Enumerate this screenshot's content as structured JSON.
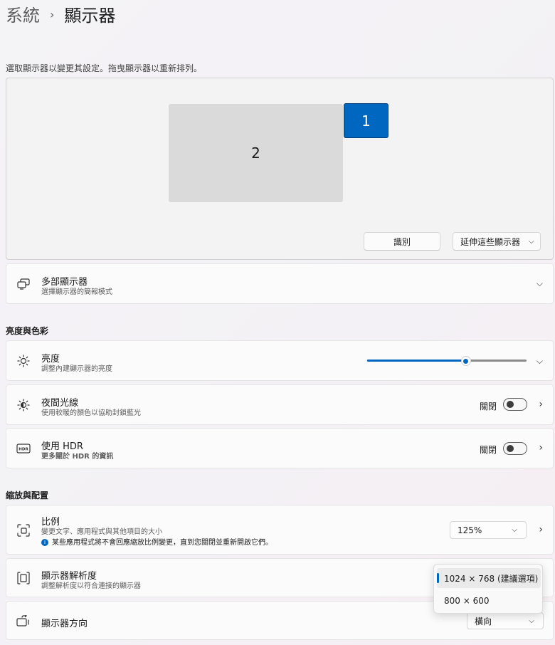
{
  "breadcrumb": {
    "parent": "系統",
    "current": "顯示器"
  },
  "hint": "選取顯示器以變更其設定。拖曳顯示器以重新排列。",
  "displays": {
    "monitor1_label": "1",
    "monitor2_label": "2"
  },
  "buttons": {
    "identify": "識別",
    "extend": "延伸這些顯示器"
  },
  "multi_display": {
    "title": "多部顯示器",
    "subtitle": "選擇顯示器的簡報模式"
  },
  "section_brightness": "亮度與色彩",
  "brightness": {
    "title": "亮度",
    "subtitle": "調整內建顯示器的亮度",
    "value_percent": 62
  },
  "night_light": {
    "title": "夜間光線",
    "subtitle": "使用較暖的顏色以協助封鎖藍光",
    "state": "關閉"
  },
  "hdr": {
    "title": "使用 HDR",
    "link": "更多關於 HDR 的資訊",
    "state": "關閉"
  },
  "section_scale": "縮放與配置",
  "scale": {
    "title": "比例",
    "subtitle": "變更文字、應用程式與其他項目的大小",
    "note": "某些應用程式將不會回應縮放比例變更，直到您關閉並重新開啟它們。",
    "value": "125%"
  },
  "resolution": {
    "title": "顯示器解析度",
    "subtitle": "調整解析度以符合連接的顯示器",
    "options": [
      "1024 × 768 (建議選項)",
      "800 × 600"
    ]
  },
  "orientation": {
    "title": "顯示器方向",
    "value": "橫向"
  },
  "colors": {
    "accent": "#0067c0",
    "monitor_inactive": "#dadada"
  }
}
